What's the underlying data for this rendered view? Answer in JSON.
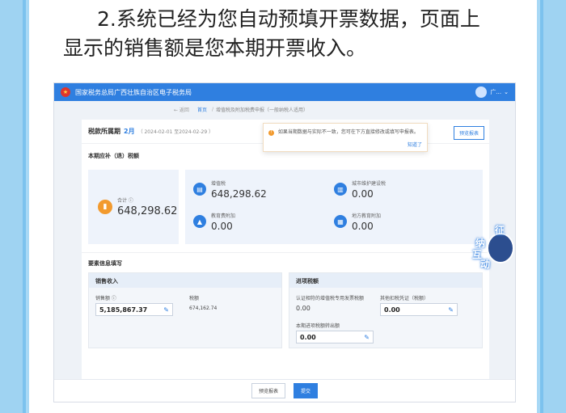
{
  "caption": {
    "line1": "2.系统已经为您自动预填开票数据，页面上",
    "line2": "显示的销售额是您本期开票收入。"
  },
  "header": {
    "title": "国家税务总局广西壮族自治区电子税务局",
    "user": "广...",
    "brand_color": "#2f7fe0"
  },
  "breadcrumb": {
    "back": "← 返回",
    "home": "首页",
    "current": "增值税及附加税费申报（一般纳税人适用）"
  },
  "period": {
    "label": "税款所属期",
    "month": "2月",
    "range": "（ 2024-02-01 至2024-02-29 ）",
    "preview_button": "预览报表"
  },
  "notice": {
    "text": "如果当期数据与实际不一致，您可在下方直接修改或填写申报表。",
    "ok": "知道了"
  },
  "tax_section": {
    "title": "本期应补（退）税额",
    "total_label": "合计",
    "total_value": "648,298.62",
    "items": [
      {
        "label": "增值税",
        "value": "648,298.62",
        "icon": "document-icon"
      },
      {
        "label": "城市维护建设税",
        "value": "0.00",
        "icon": "building-icon"
      },
      {
        "label": "教育费附加",
        "value": "0.00",
        "icon": "graduation-cap-icon"
      },
      {
        "label": "地方教育附加",
        "value": "0.00",
        "icon": "book-icon"
      }
    ]
  },
  "elements_section": {
    "title": "要素信息填写",
    "sales": {
      "title": "销售收入",
      "sales_label": "销售额",
      "sales_value": "5,185,867.37",
      "tax_label": "税额",
      "tax_value": "674,162.74"
    },
    "input_tax": {
      "title": "进项税额",
      "certified_label": "认证相符的增值税专用发票税额",
      "certified_value": "0.00",
      "other_label": "其他扣税凭证（税额）",
      "other_value": "0.00",
      "transfer_label": "本期进项税额转出额",
      "transfer_value": "0.00"
    }
  },
  "footer": {
    "preview": "预览报表",
    "submit": "提交"
  },
  "mascot": {
    "chars": [
      "征",
      "纳",
      "互",
      "动"
    ]
  }
}
